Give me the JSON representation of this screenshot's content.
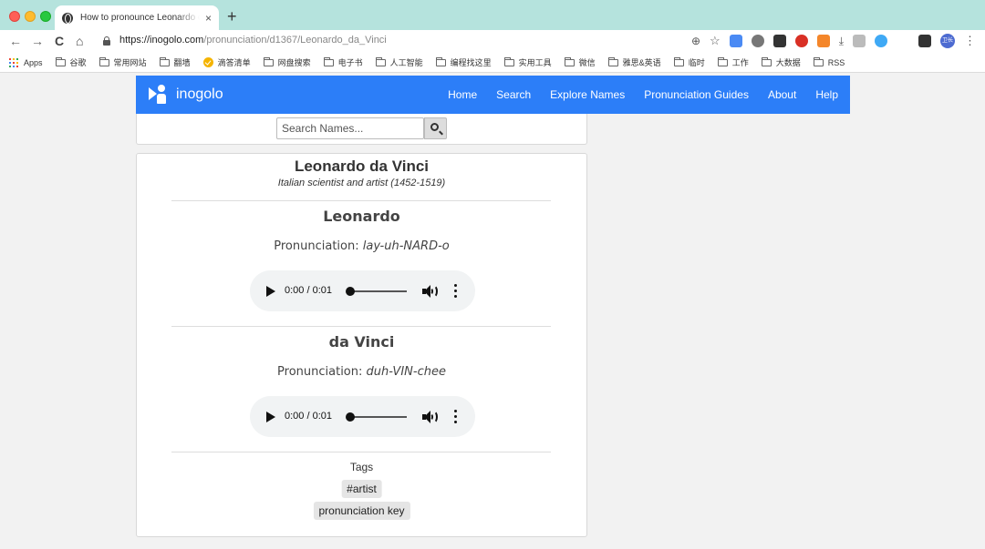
{
  "browser": {
    "tab_title": "How to pronounce Leonardo da Vinci",
    "tab_close": "×",
    "new_tab": "+",
    "url_host": "https://inogolo.com",
    "url_path": "/pronunciation/d1367/Leonardo_da_Vinci",
    "nav": {
      "back": "←",
      "forward": "→",
      "reload": "C",
      "home": "⌂"
    },
    "toolbar_icons": {
      "zoom": "⊕",
      "star": "☆",
      "download": "⤓",
      "menu": "⋮"
    },
    "avatar_text": "卫长",
    "bookmarks": [
      "Apps",
      "谷歌",
      "常用网站",
      "翻墙",
      "滴答清单",
      "网盘搜索",
      "电子书",
      "人工智能",
      "编程找这里",
      "实用工具",
      "微信",
      "雅思&英语",
      "临时",
      "工作",
      "大数据",
      "RSS"
    ]
  },
  "site": {
    "logo_text": "inogolo",
    "nav_links": [
      "Home",
      "Search",
      "Explore Names",
      "Pronunciation Guides",
      "About",
      "Help"
    ],
    "search_placeholder": "Search Names...",
    "person": {
      "name": "Leonardo da Vinci",
      "description": "Italian scientist and artist (1452-1519)"
    },
    "parts": [
      {
        "name": "Leonardo",
        "pronunciation_label": "Pronunciation:",
        "pronunciation": "lay-uh-NARD-o",
        "audio_time": "0:00 / 0:01"
      },
      {
        "name": "da Vinci",
        "pronunciation_label": "Pronunciation:",
        "pronunciation": "duh-VIN-chee",
        "audio_time": "0:00 / 0:01"
      }
    ],
    "tags_label": "Tags",
    "tags": [
      "#artist",
      "pronunciation key"
    ]
  },
  "colors": {
    "titlebar": "#b5e3dd",
    "brand_blue": "#2c7ef8",
    "page_bg": "#f2f2f2"
  }
}
